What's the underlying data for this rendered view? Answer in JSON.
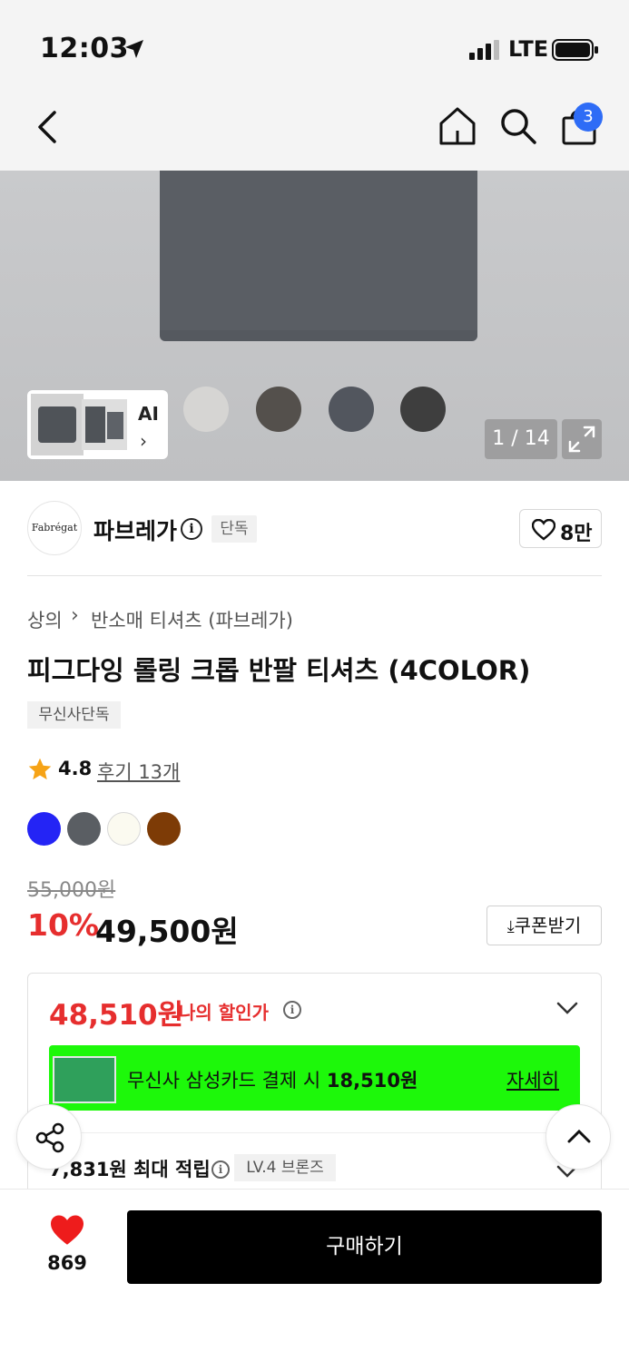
{
  "status_bar": {
    "time": "12:03",
    "network": "LTE"
  },
  "header": {
    "cart_count": "3"
  },
  "gallery": {
    "ai_label": "AI",
    "counter": "1 / 14",
    "color_swatches": [
      "#d6d5d3",
      "#54504c",
      "#52565e",
      "#3e3e3e"
    ]
  },
  "brand": {
    "logo_text": "Fabrégat",
    "name": "파브레가",
    "tag": "단독",
    "likes": "8만"
  },
  "breadcrumb": [
    "상의",
    "반소매 티셔츠 (파브레가)"
  ],
  "product": {
    "title": "피그다잉 롤링 크롭 반팔 티셔츠 (4COLOR)",
    "exclusive_tag": "무신사단독",
    "rating": "4.8",
    "reviews": "후기 13개",
    "colors": [
      "#2424f5",
      "#5a5e63",
      "#fbfaf0",
      "#7d3b06"
    ]
  },
  "price": {
    "original": "55,000원",
    "discount_rate": "10%",
    "sale": "49,500원",
    "coupon_label": "쿠폰받기"
  },
  "discount_box": {
    "my_price": "48,510원",
    "my_price_label": "나의 할인가",
    "card_text_prefix": "무신사 삼성카드 결제 시 ",
    "card_text_amount": "18,510원",
    "card_detail": "자세히",
    "points": "7,831원 최대 적립",
    "level_tag": "LV.4 브론즈"
  },
  "bottom": {
    "heart_count": "869",
    "buy_label": "구매하기"
  },
  "colors": {
    "accent_red": "#e62e2e",
    "banner_green": "#1df80a",
    "badge_blue": "#2e6cf6"
  }
}
